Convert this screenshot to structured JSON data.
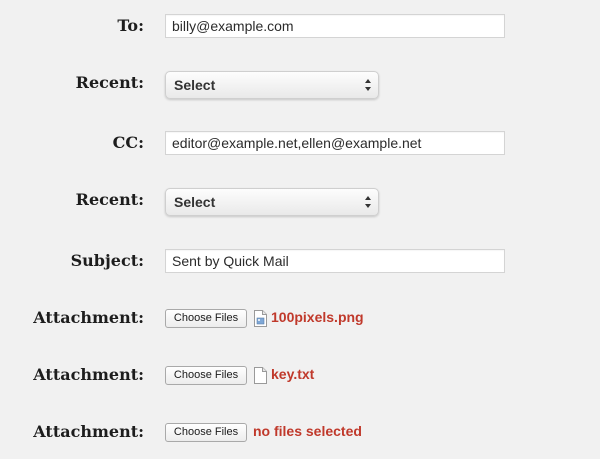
{
  "form": {
    "to_label": "To:",
    "to_value": "billy@example.com",
    "recent1_label": "Recent:",
    "recent1_value": "Select",
    "cc_label": "CC:",
    "cc_value": "editor@example.net,ellen@example.net",
    "recent2_label": "Recent:",
    "recent2_value": "Select",
    "subject_label": "Subject:",
    "subject_value": "Sent by Quick Mail",
    "attachments": [
      {
        "label": "Attachment:",
        "button": "Choose Files",
        "filename": "100pixels.png",
        "icon": "image-file-icon"
      },
      {
        "label": "Attachment:",
        "button": "Choose Files",
        "filename": "key.txt",
        "icon": "text-file-icon"
      },
      {
        "label": "Attachment:",
        "button": "Choose Files",
        "filename": "no files selected",
        "icon": ""
      }
    ]
  },
  "colors": {
    "background": "#f1f1f1",
    "filename_text": "#c0392b",
    "label_text": "#1d1d1d"
  }
}
